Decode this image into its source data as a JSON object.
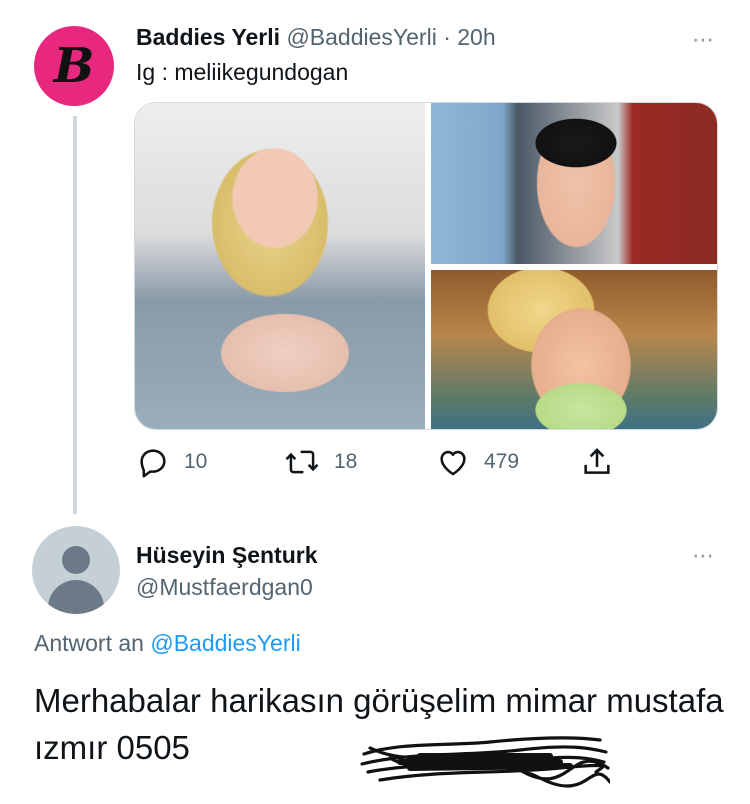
{
  "tweet": {
    "author_name": "Baddies Yerli",
    "handle": "@BaddiesYerli",
    "separator": "·",
    "time": "20h",
    "avatar_letter": "B",
    "text": "Ig : meliikegundogan",
    "more_icon": "⋯",
    "stats": {
      "replies": "10",
      "retweets": "18",
      "likes": "479"
    }
  },
  "reply": {
    "author_name": "Hüseyin Şenturk",
    "handle": "@Mustfaerdgan0",
    "more_icon": "⋯",
    "reply_to_label": "Antwort an",
    "reply_to_handle": "@BaddiesYerli",
    "text": "Merhabalar harikasın görüşelim mimar mustafa ızmır 0505"
  },
  "colors": {
    "brand_pink": "#e8277e",
    "link_blue": "#1d9bf0",
    "muted_gray": "#536471"
  }
}
